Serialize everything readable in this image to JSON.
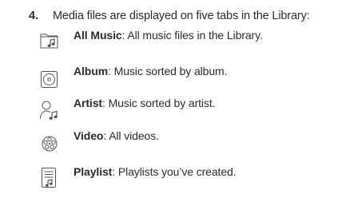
{
  "step": {
    "number": "4.",
    "text": "Media files are displayed on five tabs in the Library:"
  },
  "tabs": [
    {
      "name": "All Music",
      "separator": ": ",
      "description": "All music files in the Library.",
      "icon": "music-folder-icon"
    },
    {
      "name": "Album",
      "separator": ": ",
      "description": "Music sorted by album.",
      "icon": "album-disc-icon"
    },
    {
      "name": "Artist",
      "separator": ": ",
      "description": "Music sorted by artist.",
      "icon": "artist-person-icon"
    },
    {
      "name": "Video",
      "separator": ": ",
      "description": "All videos.",
      "icon": "video-reel-icon"
    },
    {
      "name": "Playlist",
      "separator": ": ",
      "description": "Playlists you’ve created.",
      "icon": "playlist-icon"
    }
  ]
}
